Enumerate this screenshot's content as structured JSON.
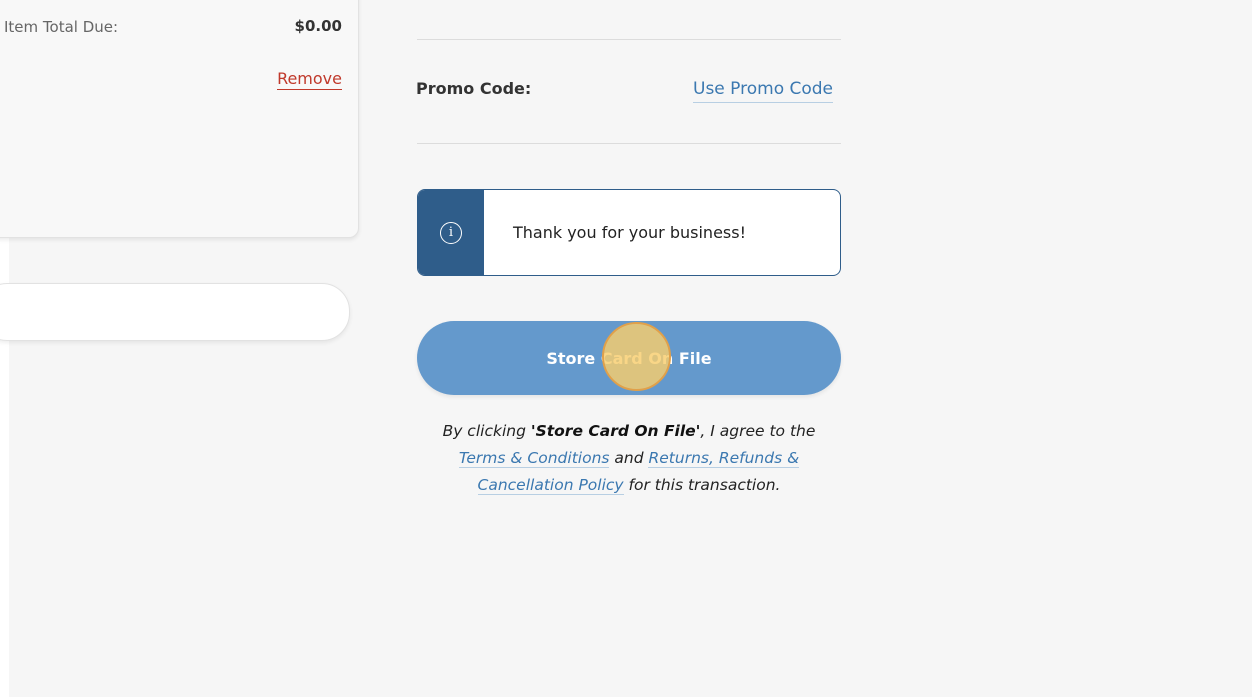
{
  "summary": {
    "item_total_label": "Item Total Due:",
    "item_total_value": "$0.00",
    "remove_label": "Remove"
  },
  "promo": {
    "label": "Promo Code:",
    "link_label": "Use Promo Code"
  },
  "info": {
    "icon": "info-icon",
    "icon_glyph": "i",
    "message": "Thank you for your business!"
  },
  "store_button": {
    "label": "Store Card On File"
  },
  "terms": {
    "prefix": "By clicking ",
    "button_name": "'Store Card On File'",
    "middle1": ", I agree to the ",
    "terms_link": "Terms & Conditions",
    "middle2": " and ",
    "policy_link": "Returns, Refunds & Cancellation Policy",
    "suffix": " for this transaction."
  },
  "colors": {
    "accent": "#6499cc",
    "info_dark": "#2f5d8a",
    "link": "#3b78b0",
    "remove": "#c0392b",
    "click_indicator": "#f8cd6c"
  }
}
